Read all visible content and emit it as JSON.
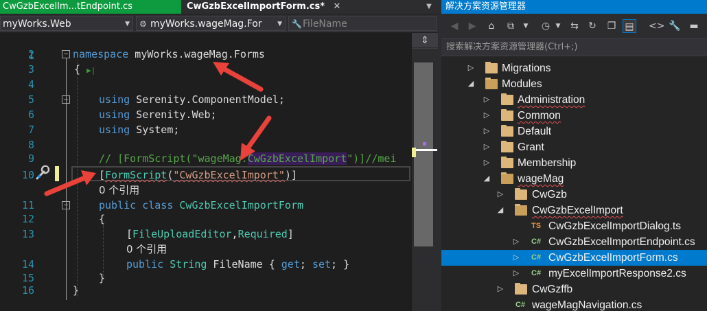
{
  "editor": {
    "tabs": [
      {
        "label": "CwGzbExcellm...tEndpoint.cs",
        "active": false
      },
      {
        "label": "CwGzbExcelImportForm.cs*",
        "active": true
      }
    ],
    "nav": {
      "project": "myWorks.Web",
      "type": "myWorks.wageMag.For",
      "member": "FileName"
    },
    "lines": [
      {
        "n": "1"
      },
      {
        "n": "2",
        "code": [
          "namespace",
          " myWorks.wageMag.Forms"
        ]
      },
      {
        "n": "3",
        "code": [
          "{"
        ]
      },
      {
        "n": "4"
      },
      {
        "n": "5",
        "code": [
          "using",
          " Serenity.ComponentModel;"
        ]
      },
      {
        "n": "6",
        "code": [
          "using",
          " Serenity.Web;"
        ]
      },
      {
        "n": "7",
        "code": [
          "using",
          " System;"
        ]
      },
      {
        "n": "8"
      },
      {
        "n": "9",
        "code": [
          "// [FormScript(\"wageMag.",
          "CwGzbExcelImport",
          "\")]//mei"
        ]
      },
      {
        "n": "10",
        "code": [
          "[",
          "FormScript",
          "(",
          "\"CwGzbExcelImport\"",
          ")]"
        ]
      },
      {
        "n": "",
        "code": [
          "0 个引用"
        ]
      },
      {
        "n": "11",
        "code": [
          "public",
          " ",
          "class",
          " ",
          "CwGzbExcelImportForm"
        ]
      },
      {
        "n": "12",
        "code": [
          "{"
        ]
      },
      {
        "n": "13",
        "code": [
          "[",
          "FileUploadEditor",
          ",",
          "Required",
          "]"
        ]
      },
      {
        "n": "",
        "code": [
          "0 个引用"
        ]
      },
      {
        "n": "14",
        "code": [
          "public",
          " ",
          "String",
          " FileName { ",
          "get",
          "; ",
          "set",
          "; }"
        ]
      },
      {
        "n": "15",
        "code": [
          "}"
        ]
      },
      {
        "n": "16",
        "code": [
          "}"
        ]
      }
    ]
  },
  "solution_explorer": {
    "title": "解决方案资源管理器",
    "search_placeholder": "搜索解决方案资源管理器(Ctrl+;)",
    "nodes": [
      {
        "label": "Migrations",
        "kind": "folder",
        "expanded": false
      },
      {
        "label": "Modules",
        "kind": "folder",
        "expanded": true
      },
      {
        "label": "Administration",
        "kind": "folder",
        "expanded": false,
        "squiggle": true
      },
      {
        "label": "Common",
        "kind": "folder",
        "expanded": false,
        "squiggle": true
      },
      {
        "label": "Default",
        "kind": "folder",
        "expanded": false
      },
      {
        "label": "Grant",
        "kind": "folder",
        "expanded": false
      },
      {
        "label": "Membership",
        "kind": "folder",
        "expanded": false
      },
      {
        "label": "wageMag",
        "kind": "folder",
        "expanded": true,
        "squiggle": true
      },
      {
        "label": "CwGzb",
        "kind": "folder",
        "expanded": false
      },
      {
        "label": "CwGzbExcelImport",
        "kind": "folder",
        "expanded": true,
        "squiggle": true
      },
      {
        "label": "CwGzbExcelImportDialog.ts",
        "kind": "ts"
      },
      {
        "label": "CwGzbExcelImportEndpoint.cs",
        "kind": "cs",
        "expanded": false
      },
      {
        "label": "CwGzbExcelImportForm.cs",
        "kind": "cs",
        "expanded": false,
        "selected": true
      },
      {
        "label": "myExcelImportResponse2.cs",
        "kind": "cs",
        "expanded": false
      },
      {
        "label": "CwGzffb",
        "kind": "folder",
        "expanded": false
      },
      {
        "label": "wageMagNavigation.cs",
        "kind": "cs"
      }
    ]
  },
  "colors": {
    "keyword": "#569cd6",
    "type": "#4ec9b0",
    "string": "#d69d85",
    "comment": "#57a64a",
    "accent": "#007acc",
    "annotation_arrow": "#e8423a"
  }
}
